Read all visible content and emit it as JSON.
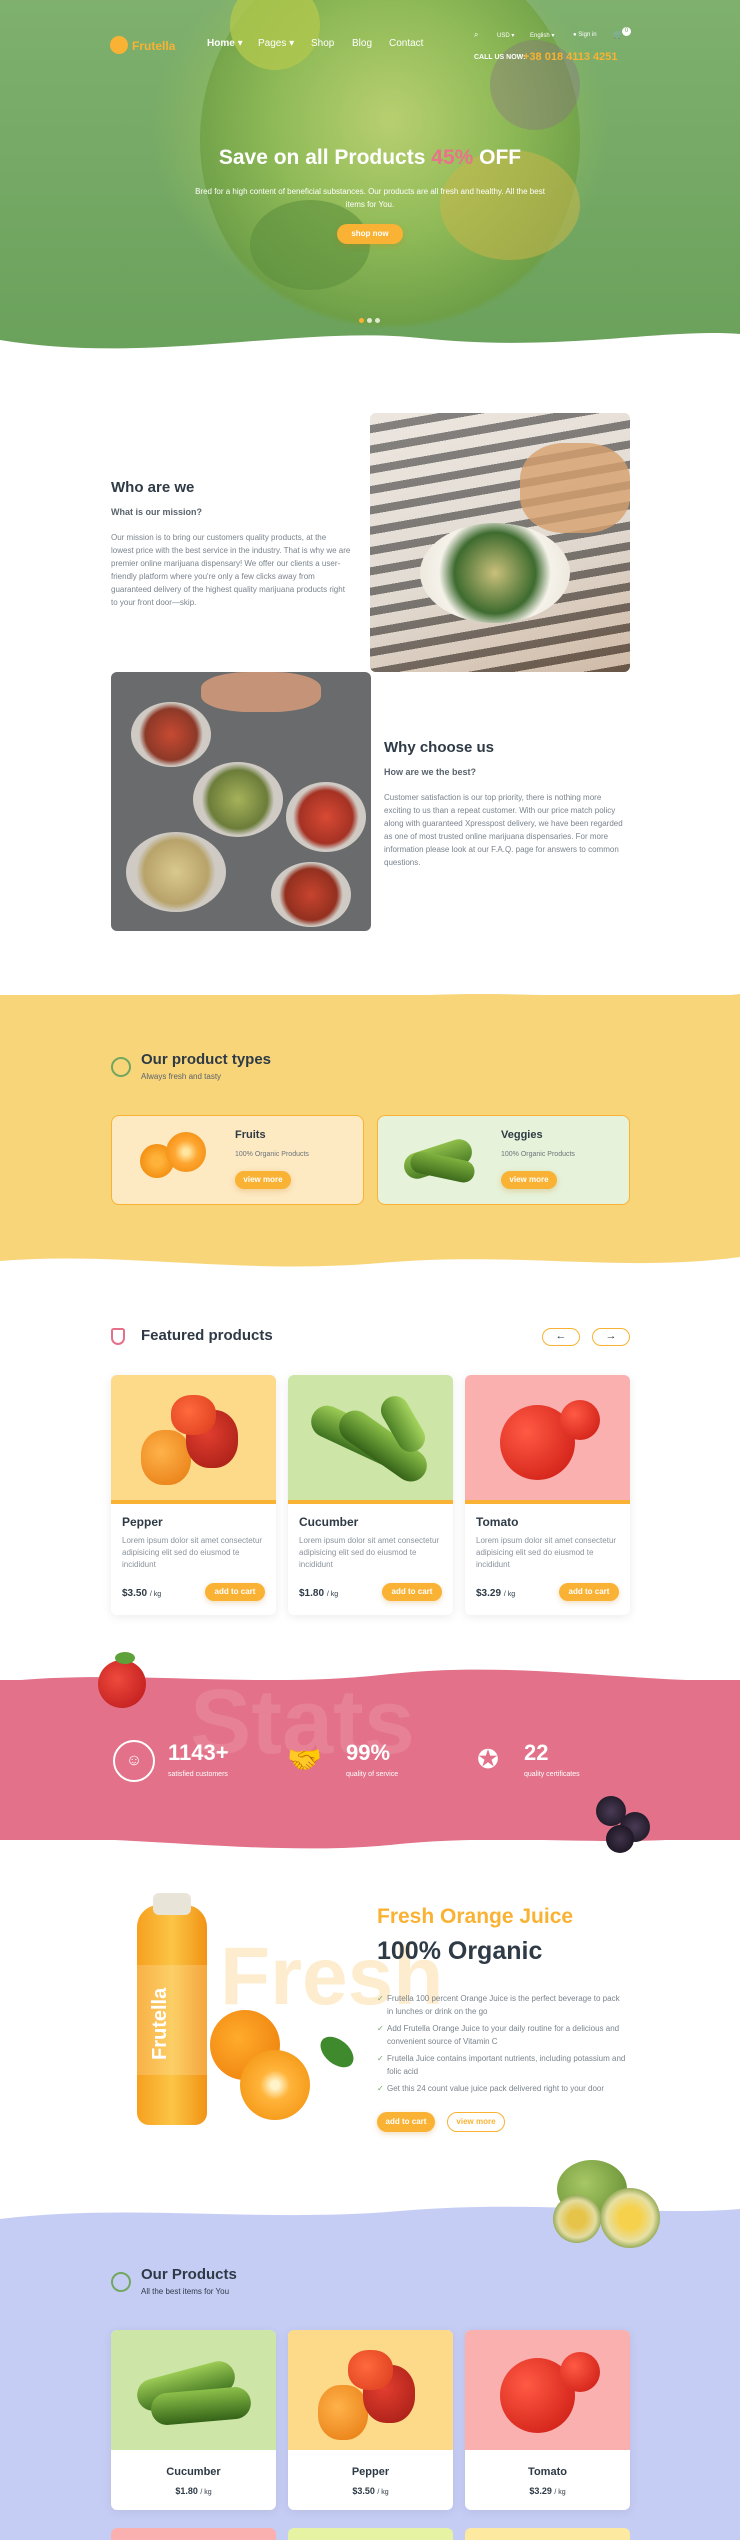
{
  "brand": {
    "name": "Frutella",
    "accent": "#f9b233",
    "green": "#72a760",
    "pink": "#e27189"
  },
  "nav": {
    "items": [
      "Home",
      "Pages",
      "Shop",
      "Blog",
      "Contact"
    ],
    "currency": "USD",
    "language": "English",
    "signin": "Sign in",
    "cart_count": "0",
    "call_label": "CALL US NOW:",
    "phone": "+38 018 4113 4251"
  },
  "hero": {
    "title_pre": "Save on all Products",
    "title_pct": "45%",
    "title_post": "OFF",
    "text": "Bred for a high content of beneficial substances. Our products are all fresh and healthy. All the best items for You.",
    "button": "shop now"
  },
  "who": {
    "title": "Who are we",
    "subtitle": "What is our mission?",
    "text": "Our mission is to bring our customers quality products, at the lowest price with the best service in the industry. That is why we are premier online marijuana dispensary! We offer our clients a user-friendly platform where you're only a few clicks away from guaranteed delivery of the highest quality marijuana products right to your front door—skip."
  },
  "why": {
    "title": "Why choose us",
    "subtitle": "How are we the best?",
    "text": "Customer satisfaction is our top priority, there is nothing more exciting to us than a repeat customer. With our price match policy along with guaranteed Xpresspost delivery, we have been regarded as one of most trusted online marijuana dispensaries. For more information please look at our F.A.Q. page for answers to common questions."
  },
  "types": {
    "title": "Our product types",
    "subtitle": "Always fresh and tasty",
    "cards": [
      {
        "name": "Fruits",
        "desc": "100% Organic Products",
        "button": "view more"
      },
      {
        "name": "Veggies",
        "desc": "100% Organic Products",
        "button": "view more"
      }
    ]
  },
  "featured": {
    "title": "Featured products",
    "products": [
      {
        "name": "Pepper",
        "desc": "Lorem ipsum dolor sit amet consectetur adipisicing elit sed do eiusmod te incididunt",
        "price": "$3.50",
        "unit": "/ kg",
        "button": "add to cart"
      },
      {
        "name": "Cucumber",
        "desc": "Lorem ipsum dolor sit amet consectetur adipisicing elit sed do eiusmod te incididunt",
        "price": "$1.80",
        "unit": "/ kg",
        "button": "add to cart"
      },
      {
        "name": "Tomato",
        "desc": "Lorem ipsum dolor sit amet consectetur adipisicing elit sed do eiusmod te incididunt",
        "price": "$3.29",
        "unit": "/ kg",
        "button": "add to cart"
      }
    ]
  },
  "stats": {
    "watermark": "Stats",
    "items": [
      {
        "value": "1143+",
        "label": "satisfied customers"
      },
      {
        "value": "99%",
        "label": "quality of service"
      },
      {
        "value": "22",
        "label": "quality certificates"
      }
    ]
  },
  "juice": {
    "title1": "Fresh Orange Juice",
    "title2": "100% Organic",
    "watermark": "Fresh",
    "bottle_label": "Frutella",
    "points": [
      "Frutella 100 percent Orange Juice is the perfect beverage to pack in lunches or drink on the go",
      "Add Frutella Orange Juice to your daily routine for a delicious and convenient source of Vitamin C",
      "Frutella Juice contains important nutrients, including potassium and folic acid",
      "Get this 24 count value juice pack delivered right to your door"
    ],
    "button1": "add to cart",
    "button2": "view more"
  },
  "our_products": {
    "title": "Our Products",
    "subtitle": "All the best items for You",
    "products": [
      {
        "name": "Cucumber",
        "price": "$1.80",
        "unit": "/ kg"
      },
      {
        "name": "Pepper",
        "price": "$3.50",
        "unit": "/ kg"
      },
      {
        "name": "Tomato",
        "price": "$3.29",
        "unit": "/ kg"
      }
    ]
  }
}
